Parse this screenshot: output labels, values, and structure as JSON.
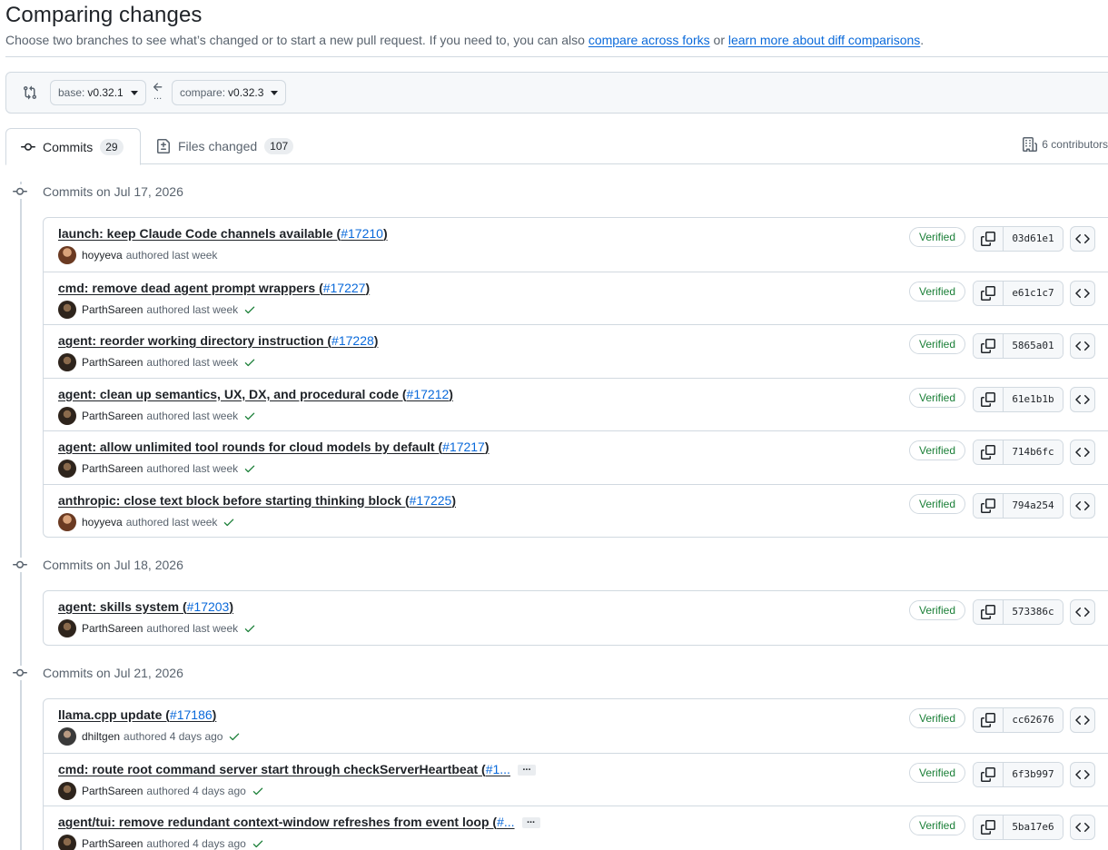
{
  "header": {
    "title": "Comparing changes",
    "subtitle_pre": "Choose two branches to see what’s changed or to start a new pull request. If you need to, you can also ",
    "link_forks": "compare across forks",
    "subtitle_or": " or ",
    "link_learn": "learn more about diff comparisons",
    "subtitle_end": "."
  },
  "range": {
    "base_label": "base:",
    "base_value": "v0.32.1",
    "compare_label": "compare:",
    "compare_value": "v0.32.3",
    "dots": "..."
  },
  "tabs": [
    {
      "label": "Commits",
      "count": "29"
    },
    {
      "label": "Files changed",
      "count": "107"
    }
  ],
  "contributors": "6 contributors",
  "groups": [
    {
      "heading": "Commits on Jul 17, 2026",
      "commits": [
        {
          "title": "launch: keep Claude Code channels available (",
          "pr": "#17210",
          "close": ")",
          "author": "hoyyeva",
          "time": "authored last week",
          "check": false,
          "verified": "Verified",
          "sha": "03d61e1",
          "avatar": "brown"
        },
        {
          "title": "cmd: remove dead agent prompt wrappers (",
          "pr": "#17227",
          "close": ")",
          "author": "ParthSareen",
          "time": "authored last week",
          "check": true,
          "verified": "Verified",
          "sha": "e61c1c7",
          "avatar": "dark"
        },
        {
          "title": "agent: reorder working directory instruction (",
          "pr": "#17228",
          "close": ")",
          "author": "ParthSareen",
          "time": "authored last week",
          "check": true,
          "verified": "Verified",
          "sha": "5865a01",
          "avatar": "dark"
        },
        {
          "title": "agent: clean up semantics, UX, DX, and procedural code (",
          "pr": "#17212",
          "close": ")",
          "author": "ParthSareen",
          "time": "authored last week",
          "check": true,
          "verified": "Verified",
          "sha": "61e1b1b",
          "avatar": "dark"
        },
        {
          "title": "agent: allow unlimited tool rounds for cloud models by default (",
          "pr": "#17217",
          "close": ")",
          "author": "ParthSareen",
          "time": "authored last week",
          "check": true,
          "verified": "Verified",
          "sha": "714b6fc",
          "avatar": "dark"
        },
        {
          "title": "anthropic: close text block before starting thinking block (",
          "pr": "#17225",
          "close": ")",
          "author": "hoyyeva",
          "time": "authored last week",
          "check": true,
          "verified": "Verified",
          "sha": "794a254",
          "avatar": "brown"
        }
      ]
    },
    {
      "heading": "Commits on Jul 18, 2026",
      "commits": [
        {
          "title": "agent: skills system (",
          "pr": "#17203",
          "close": ")",
          "author": "ParthSareen",
          "time": "authored last week",
          "check": true,
          "verified": "Verified",
          "sha": "573386c",
          "avatar": "dark"
        }
      ]
    },
    {
      "heading": "Commits on Jul 21, 2026",
      "commits": [
        {
          "title": "llama.cpp update (",
          "pr": "#17186",
          "close": ")",
          "author": "dhiltgen",
          "time": "authored 4 days ago",
          "check": true,
          "verified": "Verified",
          "sha": "cc62676",
          "avatar": "grey"
        },
        {
          "title": "cmd: route root command server start through checkServerHeartbeat (",
          "pr": "#1...",
          "close": "",
          "ellipsis": "...",
          "author": "ParthSareen",
          "time": "authored 4 days ago",
          "check": true,
          "verified": "Verified",
          "sha": "6f3b997",
          "avatar": "dark"
        },
        {
          "title": "agent/tui: remove redundant context-window refreshes from event loop (",
          "pr": "#...",
          "close": "",
          "ellipsis": "...",
          "author": "ParthSareen",
          "time": "authored 4 days ago",
          "check": true,
          "verified": "Verified",
          "sha": "5ba17e6",
          "avatar": "dark"
        }
      ]
    }
  ],
  "colors": {
    "link": "#0969da",
    "verified": "#1a7f37",
    "border": "#d1d9e0"
  }
}
